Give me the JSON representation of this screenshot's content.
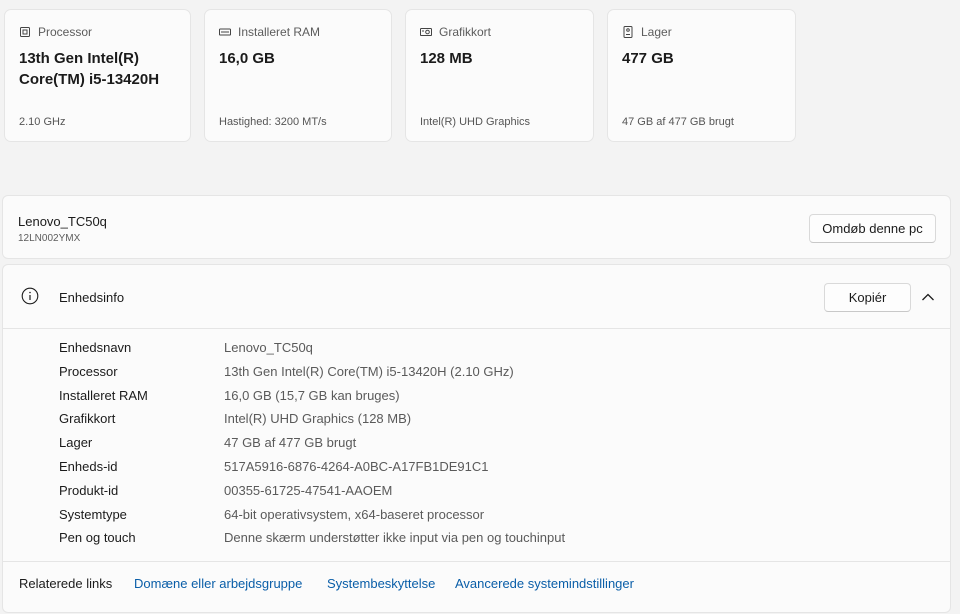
{
  "cards": [
    {
      "icon": "processor-icon",
      "header": "Processor",
      "value": "13th Gen Intel(R) Core(TM) i5-13420H",
      "sub": "2.10 GHz"
    },
    {
      "icon": "ram-icon",
      "header": "Installeret RAM",
      "value": "16,0 GB",
      "sub": "Hastighed: 3200 MT/s"
    },
    {
      "icon": "graphics-card-icon",
      "header": "Grafikkort",
      "value": "128 MB",
      "sub": "Intel(R) UHD Graphics"
    },
    {
      "icon": "storage-icon",
      "header": "Lager",
      "value": "477 GB",
      "sub": "47 GB af 477 GB brugt"
    }
  ],
  "pc": {
    "name": "Lenovo_TC50q",
    "model": "12LN002YMX",
    "rename_label": "Omdøb denne pc"
  },
  "device_info": {
    "title": "Enhedsinfo",
    "copy_label": "Kopiér",
    "rows": [
      {
        "key": "Enhedsnavn",
        "value": "Lenovo_TC50q"
      },
      {
        "key": "Processor",
        "value": "13th Gen Intel(R) Core(TM) i5-13420H (2.10 GHz)"
      },
      {
        "key": "Installeret RAM",
        "value": "16,0 GB (15,7 GB kan bruges)"
      },
      {
        "key": "Grafikkort",
        "value": "Intel(R) UHD Graphics (128 MB)"
      },
      {
        "key": "Lager",
        "value": "47 GB af 477 GB brugt"
      },
      {
        "key": "Enheds-id",
        "value": "517A5916-6876-4264-A0BC-A17FB1DE91C1"
      },
      {
        "key": "Produkt-id",
        "value": "00355-61725-47541-AAOEM"
      },
      {
        "key": "Systemtype",
        "value": "64-bit operativsystem, x64-baseret processor"
      },
      {
        "key": "Pen og touch",
        "value": "Denne skærm understøtter ikke input via pen og touchinput"
      }
    ]
  },
  "related": {
    "label": "Relaterede links",
    "links": [
      "Domæne eller arbejdsgruppe",
      "Systembeskyttelse",
      "Avancerede systemindstillinger"
    ]
  },
  "colors": {
    "link": "#0a5ea8",
    "card_bg": "#fbfbfb",
    "page_bg": "#f3f3f3"
  }
}
